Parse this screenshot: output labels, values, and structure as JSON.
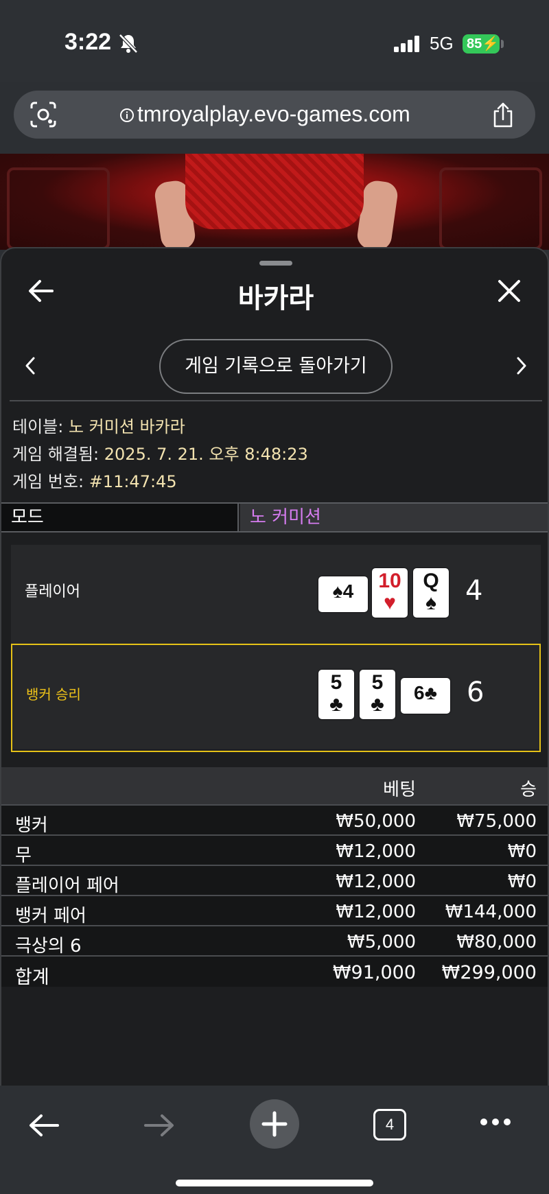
{
  "status": {
    "time": "3:22",
    "network": "5G",
    "battery": "85"
  },
  "browser": {
    "url": "tmroyalplay.evo-games.com",
    "tab_count": "4"
  },
  "sheet": {
    "title": "바카라",
    "back_to_history": "게임 기록으로 돌아가기",
    "info": {
      "table_label": "테이블:",
      "table_value": "노 커미션 바카라",
      "resolved_label": "게임 해결됨:",
      "resolved_value": "2025. 7. 21. 오후 8:48:23",
      "number_label": "게임 번호:",
      "number_value": "#11:47:45"
    },
    "mode": {
      "label": "모드",
      "value": "노 커미션"
    },
    "player": {
      "label": "플레이어",
      "score": "4",
      "cards": [
        {
          "rank": "4",
          "suit": "♠",
          "color": "#111111",
          "orientation": "sideways"
        },
        {
          "rank": "10",
          "suit": "♥",
          "color": "#d21e2b",
          "orientation": "upright"
        },
        {
          "rank": "Q",
          "suit": "♠",
          "color": "#111111",
          "orientation": "upright"
        }
      ]
    },
    "banker": {
      "label": "뱅커 승리",
      "score": "6",
      "cards": [
        {
          "rank": "5",
          "suit": "♣",
          "color": "#111111",
          "orientation": "upright"
        },
        {
          "rank": "5",
          "suit": "♣",
          "color": "#111111",
          "orientation": "upright"
        },
        {
          "rank": "6",
          "suit": "♣",
          "color": "#111111",
          "orientation": "sideways"
        }
      ]
    },
    "bets": {
      "headers": {
        "bet": "베팅",
        "win": "승"
      },
      "rows": [
        {
          "name": "뱅커",
          "bet": "₩50,000",
          "win": "₩75,000"
        },
        {
          "name": "무",
          "bet": "₩12,000",
          "win": "₩0"
        },
        {
          "name": "플레이어 페어",
          "bet": "₩12,000",
          "win": "₩0"
        },
        {
          "name": "뱅커 페어",
          "bet": "₩12,000",
          "win": "₩144,000"
        },
        {
          "name": "극상의 6",
          "bet": "₩5,000",
          "win": "₩80,000"
        }
      ],
      "total": {
        "name": "합계",
        "bet": "₩91,000",
        "win": "₩299,000"
      }
    }
  },
  "colors": {
    "highlight": "#e6c217",
    "mode_value": "#d67cf0",
    "info_value": "#f3e3b0",
    "battery": "#34c759"
  }
}
